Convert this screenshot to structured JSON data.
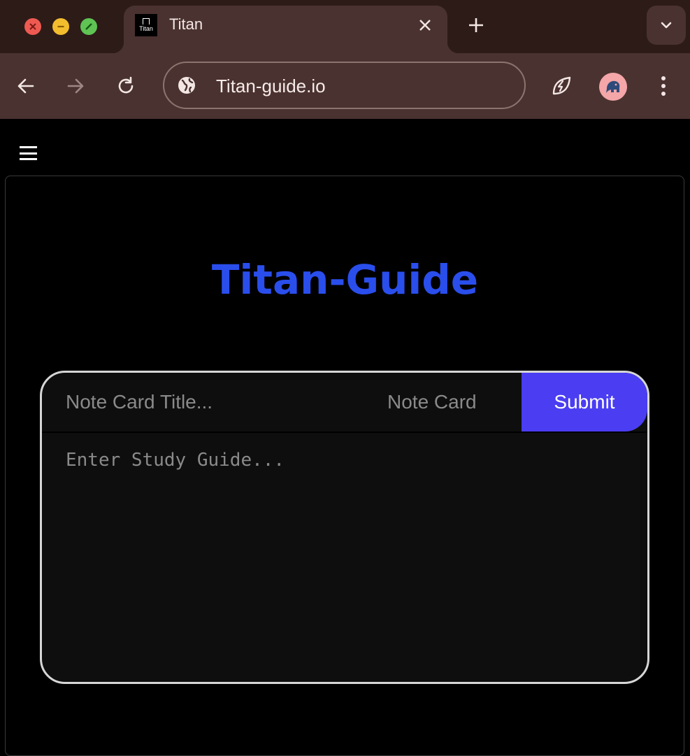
{
  "browser": {
    "tab": {
      "title": "Titan",
      "favicon_text": "Titan"
    },
    "address_bar": {
      "url": "Titan-guide.io"
    },
    "icons": {
      "close": "close-icon",
      "minimize": "minimize-icon",
      "maximize": "maximize-icon",
      "new_tab": "plus-icon",
      "tab_search": "chevron-down-icon",
      "back": "arrow-left-icon",
      "forward": "arrow-right-icon",
      "reload": "reload-icon",
      "site_info": "globe-icon",
      "extension": "leaf-bolt-icon",
      "menu": "kebab-menu-icon"
    },
    "colors": {
      "tabstrip": "#2d1b18",
      "toolbar": "#4a3230",
      "avatar_bg": "#f4a6a8"
    }
  },
  "page": {
    "menu_icon": "hamburger-icon",
    "heading": "Titan-Guide",
    "form": {
      "title_placeholder": "Note Card Title...",
      "type_label": "Note Card",
      "submit_label": "Submit",
      "guide_placeholder": "Enter Study Guide..."
    },
    "colors": {
      "heading": "#2a4eec",
      "submit_bg": "#4a3df2",
      "card_border": "#d6d6d6"
    }
  }
}
